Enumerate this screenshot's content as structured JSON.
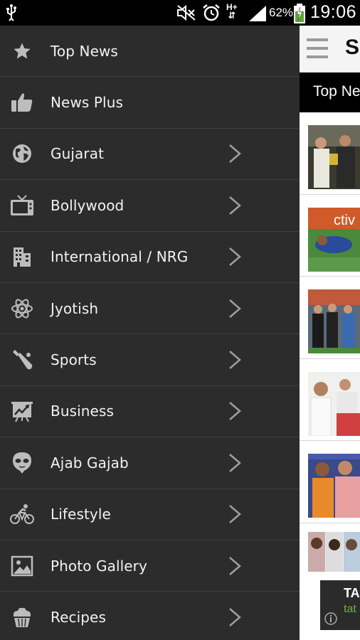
{
  "status_bar": {
    "usb_icon": "usb-icon",
    "mute_icon": "mute-icon",
    "alarm_icon": "alarm-icon",
    "network_label": "H+",
    "signal_icon": "signal-icon",
    "battery_percent": "62%",
    "battery_icon": "battery-charging-icon",
    "time": "19:06"
  },
  "drawer": {
    "items": [
      {
        "label": "Top News",
        "icon": "star-icon",
        "has_chevron": false
      },
      {
        "label": "News Plus",
        "icon": "thumbs-up-icon",
        "has_chevron": false
      },
      {
        "label": "Gujarat",
        "icon": "globe-icon",
        "has_chevron": true
      },
      {
        "label": "Bollywood",
        "icon": "tv-icon",
        "has_chevron": true
      },
      {
        "label": "International / NRG",
        "icon": "building-icon",
        "has_chevron": true
      },
      {
        "label": "Jyotish",
        "icon": "atom-icon",
        "has_chevron": true
      },
      {
        "label": "Sports",
        "icon": "cricket-bat-icon",
        "has_chevron": true
      },
      {
        "label": "Business",
        "icon": "presentation-chart-icon",
        "has_chevron": true
      },
      {
        "label": "Ajab Gajab",
        "icon": "alien-icon",
        "has_chevron": true
      },
      {
        "label": "Lifestyle",
        "icon": "bicycle-icon",
        "has_chevron": true
      },
      {
        "label": "Photo Gallery",
        "icon": "picture-icon",
        "has_chevron": true
      },
      {
        "label": "Recipes",
        "icon": "cupcake-icon",
        "has_chevron": true
      }
    ]
  },
  "content": {
    "app_title_visible": "S",
    "section_title": "Top Ne",
    "ad": {
      "title": "TA",
      "subtitle": "tat"
    }
  },
  "colors": {
    "drawer_bg": "#2c2c2c",
    "divider": "#3f3f3f",
    "icon_gray": "#bdbdbd",
    "ad_green": "#6db33f"
  }
}
